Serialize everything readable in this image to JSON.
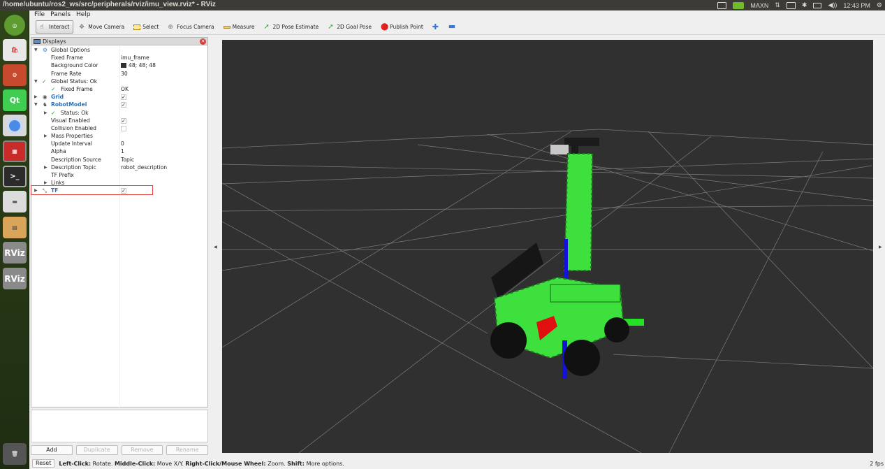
{
  "window": {
    "title": "/home/ubuntu/ros2_ws/src/peripherals/rviz/imu_view.rviz* - RViz",
    "tray": {
      "nvidia_mode": "MAXN",
      "clock": "12:43 PM"
    }
  },
  "launcher": {
    "items": [
      "ubuntu-logo-icon",
      "software-center-icon",
      "settings-icon",
      "qt-creator-icon",
      "chromium-icon",
      "app-icon",
      "terminal-icon",
      "drive-icon",
      "files-icon",
      "rviz-icon",
      "rviz-icon",
      "trash-icon"
    ],
    "rviz_label": "RViz"
  },
  "menu": {
    "file": "File",
    "panels": "Panels",
    "help": "Help"
  },
  "toolbar": {
    "interact": "Interact",
    "move_camera": "Move Camera",
    "select": "Select",
    "focus_camera": "Focus Camera",
    "measure": "Measure",
    "pose_estimate": "2D Pose Estimate",
    "goal_pose": "2D Goal Pose",
    "publish_point": "Publish Point"
  },
  "displays": {
    "title": "Displays",
    "rows": {
      "global_options": "Global Options",
      "fixed_frame_label": "Fixed Frame",
      "fixed_frame_value": "imu_frame",
      "background_color_label": "Background Color",
      "background_color_value": "48; 48; 48",
      "frame_rate_label": "Frame Rate",
      "frame_rate_value": "30",
      "global_status": "Global Status: Ok",
      "status_fixed_frame": "Fixed Frame",
      "status_fixed_frame_value": "OK",
      "grid": "Grid",
      "robot_model": "RobotModel",
      "status_ok": "Status: Ok",
      "visual_enabled": "Visual Enabled",
      "collision_enabled": "Collision Enabled",
      "mass_properties": "Mass Properties",
      "update_interval_label": "Update Interval",
      "update_interval_value": "0",
      "alpha_label": "Alpha",
      "alpha_value": "1",
      "description_source_label": "Description Source",
      "description_source_value": "Topic",
      "description_topic_label": "Description Topic",
      "description_topic_value": "robot_description",
      "tf_prefix": "TF Prefix",
      "links": "Links",
      "tf": "TF"
    },
    "checks": {
      "grid": true,
      "robot_model": true,
      "visual_enabled": true,
      "collision_enabled": false,
      "tf": true
    },
    "buttons": {
      "add": "Add",
      "duplicate": "Duplicate",
      "remove": "Remove",
      "rename": "Rename"
    }
  },
  "statusbar": {
    "reset": "Reset",
    "left_click_key": "Left-Click:",
    "left_click_text": "Rotate.",
    "middle_click_key": "Middle-Click:",
    "middle_click_text": "Move X/Y.",
    "right_click_key": "Right-Click/Mouse Wheel:",
    "right_click_text": "Zoom.",
    "shift_key": "Shift:",
    "shift_text": "More options.",
    "fps": "2 fps"
  },
  "colors": {
    "viewport_bg": "#303030",
    "robot_green": "#3ee03e",
    "axis_red": "#e01010",
    "axis_blue": "#1010e0",
    "highlight": "#e04848"
  }
}
